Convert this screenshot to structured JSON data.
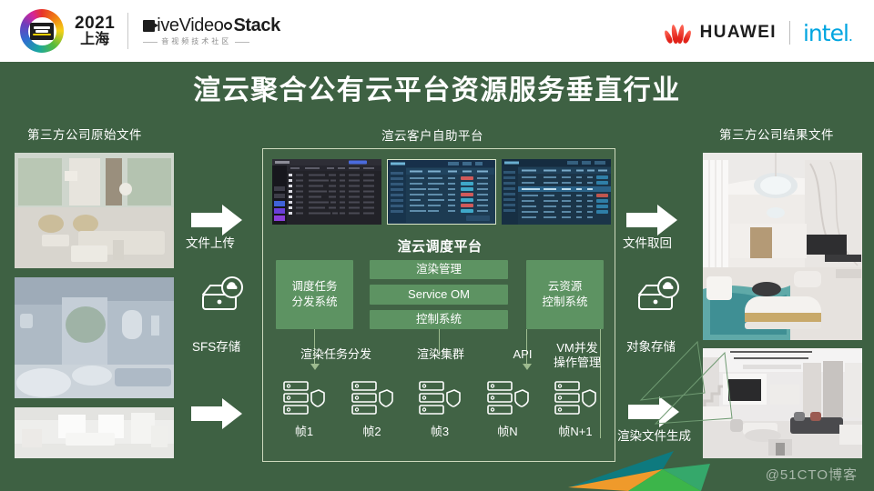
{
  "header": {
    "event_year": "2021",
    "event_city": "上海",
    "logo_word_1": "ive",
    "logo_word_2": "Video",
    "logo_word_3": "Stack",
    "logo_tagline": "音视频技术社区",
    "partner_huawei": "HUAWEI",
    "partner_intel": "intel",
    "partner_intel_tail": "."
  },
  "title": "渲云聚合公有云平台资源服务垂直行业",
  "columns": {
    "left_label": "第三方公司原始文件",
    "center_label": "渲云客户自助平台",
    "right_label": "第三方公司结果文件"
  },
  "flow": {
    "upload_arrow_label": "文件上传",
    "sfs_storage_label": "SFS存储",
    "retrieve_arrow_label": "文件取回",
    "object_storage_label": "对象存储",
    "render_output_label": "渲染文件生成"
  },
  "center": {
    "platform_name": "渲云调度平台",
    "block_left": "调度任务\n分发系统",
    "block_left_line1": "调度任务",
    "block_left_line2": "分发系统",
    "block_right_line1": "云资源",
    "block_right_line2": "控制系统",
    "block_center_1": "渲染管理",
    "block_center_2": "Service OM",
    "block_center_3": "控制系统",
    "flow_label_1": "渲染任务分发",
    "flow_label_2": "渲染集群",
    "flow_label_3": "API",
    "flow_label_4_line1": "VM并发",
    "flow_label_4_line2": "操作管理"
  },
  "servers": [
    {
      "caption": "帧1",
      "icon": "server-shield-icon"
    },
    {
      "caption": "帧2",
      "icon": "server-shield-icon"
    },
    {
      "caption": "帧3",
      "icon": "server-shield-icon"
    },
    {
      "caption": "帧N",
      "icon": "server-shield-icon"
    },
    {
      "caption": "帧N+1",
      "icon": "server-shield-icon"
    }
  ],
  "watermark": "@51CTO博客",
  "colors": {
    "background_green": "#3e6143",
    "block_green": "#5d9362",
    "panel_border": "#cdd9bd",
    "title_text": "#ffffff",
    "huawei_red": "#e2231a",
    "intel_blue": "#00a5e0"
  }
}
